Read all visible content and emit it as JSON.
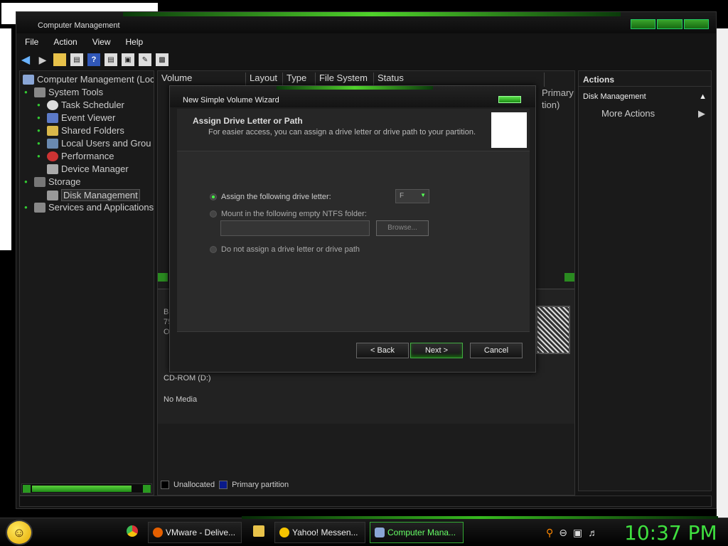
{
  "window": {
    "title": "Computer Management"
  },
  "menu": [
    "File",
    "Action",
    "View",
    "Help"
  ],
  "tree": {
    "root": "Computer Management (Loc",
    "system_tools": "System Tools",
    "task_scheduler": "Task Scheduler",
    "event_viewer": "Event Viewer",
    "shared_folders": "Shared Folders",
    "local_users": "Local Users and Grou",
    "performance": "Performance",
    "device_manager": "Device Manager",
    "storage": "Storage",
    "disk_management": "Disk Management",
    "services": "Services and Applications"
  },
  "volume_columns": [
    "Volume",
    "Layout",
    "Type",
    "File System",
    "Status"
  ],
  "volume_right_text": [
    "Primary",
    "tion)"
  ],
  "disk_left": [
    "Ba",
    "75",
    "O"
  ],
  "cdrom": {
    "label": "CD-ROM (D:)",
    "status": "No Media"
  },
  "legend": {
    "unallocated": "Unallocated",
    "primary": "Primary partition"
  },
  "actions": {
    "header": "Actions",
    "section": "Disk Management",
    "more": "More Actions"
  },
  "wizard": {
    "title": "New Simple Volume Wizard",
    "heading": "Assign Drive Letter or Path",
    "subheading": "For easier access, you can assign a drive letter or drive path to your partition.",
    "opt_letter": "Assign the following drive letter:",
    "drive_letter": "F",
    "opt_folder": "Mount in the following empty NTFS folder:",
    "browse": "Browse...",
    "opt_none": "Do not assign a drive letter or drive path",
    "back": "< Back",
    "next": "Next >",
    "cancel": "Cancel"
  },
  "taskbar": {
    "tasks": [
      "VMware - Delive...",
      "Yahoo! Messen...",
      "Computer Mana..."
    ],
    "clock": "10:37 PM"
  },
  "colors": {
    "accent_green": "#3fe03f",
    "window_bg": "#141414"
  }
}
